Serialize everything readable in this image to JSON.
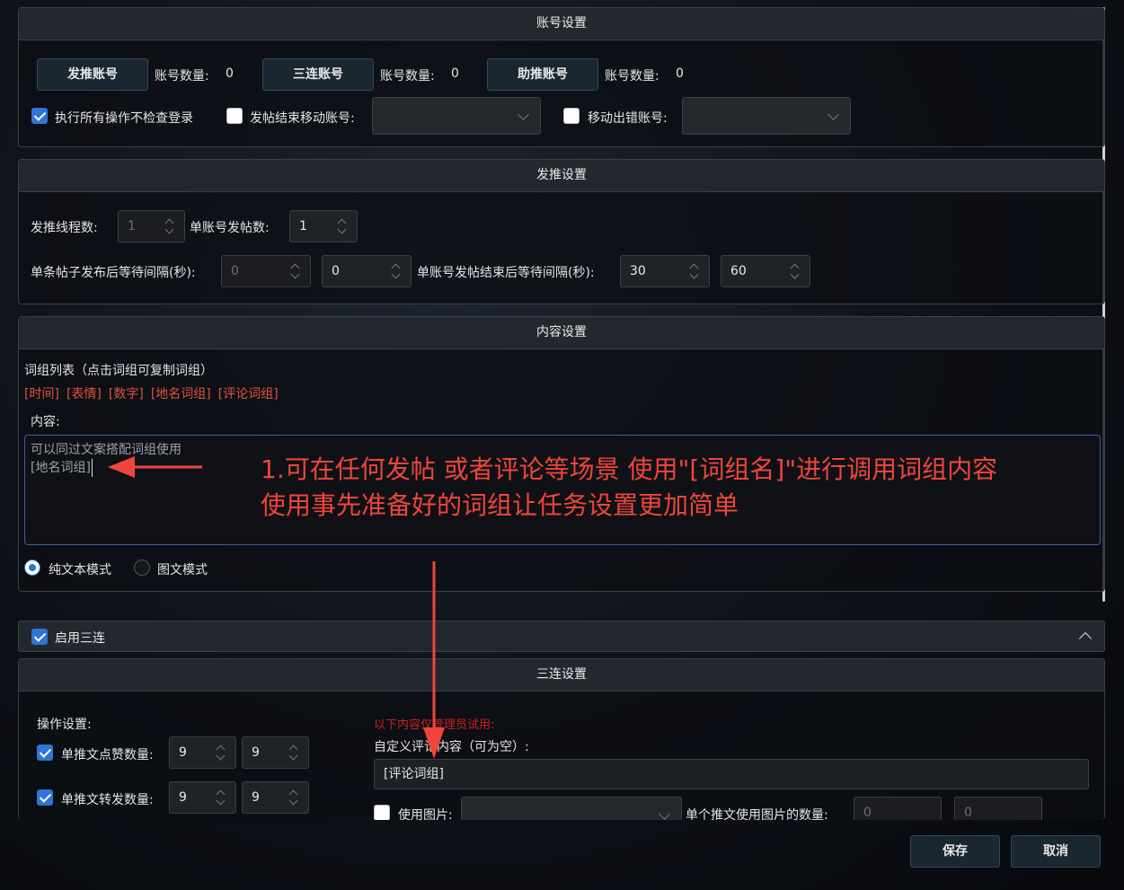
{
  "account_section": {
    "title": "账号设置",
    "buttons": [
      {
        "label": "发推账号",
        "count_label": "账号数量:",
        "count": "0"
      },
      {
        "label": "三连账号",
        "count_label": "账号数量:",
        "count": "0"
      },
      {
        "label": "助推账号",
        "count_label": "账号数量:",
        "count": "0"
      }
    ],
    "skip_login_check": {
      "label": "执行所有操作不检查登录",
      "checked": true
    },
    "move_after_post": {
      "label": "发帖结束移动账号:",
      "checked": false,
      "value": ""
    },
    "move_error": {
      "label": "移动出错账号:",
      "checked": false,
      "value": ""
    }
  },
  "post_section": {
    "title": "发推设置",
    "thread_count": {
      "label": "发推线程数:",
      "value": "1"
    },
    "posts_per_account": {
      "label": "单账号发帖数:",
      "value": "1"
    },
    "wait_after_post": {
      "label": "单条帖子发布后等待间隔(秒):",
      "min": "0",
      "max": "0"
    },
    "wait_after_account": {
      "label": "单账号发帖结束后等待间隔(秒):",
      "min": "30",
      "max": "60"
    }
  },
  "content_section": {
    "title": "内容设置",
    "wordlist_label": "词组列表（点击词组可复制词组）",
    "tags": [
      "[时间]",
      "[表情]",
      "[数字]",
      "[地名词组]",
      "[评论词组]"
    ],
    "content_label": "内容:",
    "content_lines": [
      "可以同过文案搭配词组使用",
      "[地名词组]"
    ],
    "modes": [
      {
        "label": "纯文本模式",
        "selected": true
      },
      {
        "label": "图文模式",
        "selected": false
      }
    ]
  },
  "triple": {
    "enable_label": "启用三连",
    "enabled": true,
    "title": "三连设置",
    "ops_label": "操作设置:",
    "like": {
      "label": "单推文点赞数量:",
      "checked": true,
      "min": "9",
      "max": "9"
    },
    "retweet": {
      "label": "单推文转发数量:",
      "checked": true,
      "min": "9",
      "max": "9"
    },
    "admin_note": "以下内容仅管理员试用:",
    "comment_label": "自定义评论内容（可为空）:",
    "comment_value": "[评论词组]",
    "use_image": {
      "label": "使用图片:",
      "checked": false
    },
    "image_count": {
      "label": "单个推文使用图片的数量:",
      "min": "0",
      "max": "0"
    }
  },
  "footer": {
    "save": "保存",
    "cancel": "取消"
  },
  "annotation": {
    "line1": "1.可在任何发帖 或者评论等场景 使用\"[词组名]\"进行调用词组内容",
    "line2": "使用事先准备好的词组让任务设置更加简单"
  },
  "colors": {
    "accent": "#2f74d6",
    "tag": "#e0523c",
    "annotation": "#f0453a"
  }
}
